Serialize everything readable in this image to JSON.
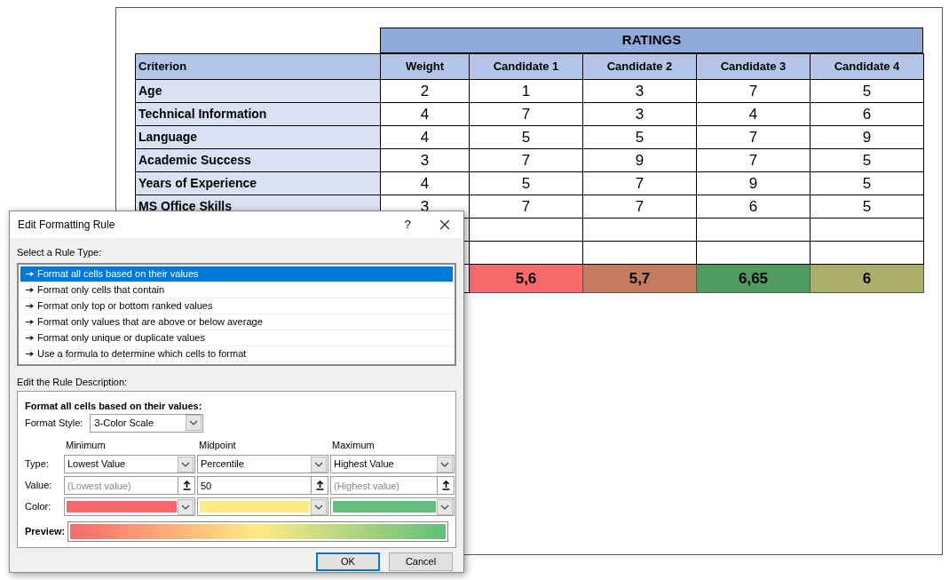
{
  "sheet": {
    "group_header": "RATINGS",
    "columns": [
      "Criterion",
      "Weight",
      "Candidate 1",
      "Candidate 2",
      "Candidate 3",
      "Candidate 4"
    ],
    "rows": [
      {
        "criterion": "Age",
        "values": [
          "2",
          "1",
          "3",
          "7",
          "5"
        ]
      },
      {
        "criterion": "Technical Information",
        "values": [
          "4",
          "7",
          "3",
          "4",
          "6"
        ]
      },
      {
        "criterion": "Language",
        "values": [
          "4",
          "5",
          "5",
          "7",
          "9"
        ]
      },
      {
        "criterion": "Academic Success",
        "values": [
          "3",
          "7",
          "9",
          "7",
          "5"
        ]
      },
      {
        "criterion": "Years of Experience",
        "values": [
          "4",
          "5",
          "7",
          "9",
          "5"
        ]
      },
      {
        "criterion": "MS Office Skills",
        "values": [
          "3",
          "7",
          "7",
          "6",
          "5"
        ]
      }
    ],
    "totals": [
      {
        "value": "5,6",
        "color": "#f8696b"
      },
      {
        "value": "5,7",
        "color": "#c47b5f"
      },
      {
        "value": "6,65",
        "color": "#4f9a5f"
      },
      {
        "value": "6",
        "color": "#abae6b"
      }
    ]
  },
  "dialog": {
    "title": "Edit Formatting Rule",
    "help": "?",
    "rule_type_label": "Select a Rule Type:",
    "rule_types": [
      {
        "label": "Format all cells based on their values",
        "selected": true
      },
      {
        "label": "Format only cells that contain",
        "selected": false
      },
      {
        "label": "Format only top or bottom ranked values",
        "selected": false
      },
      {
        "label": "Format only values that are above or below average",
        "selected": false
      },
      {
        "label": "Format only unique or duplicate values",
        "selected": false
      },
      {
        "label": "Use a formula to determine which cells to format",
        "selected": false
      }
    ],
    "description_label": "Edit the Rule Description:",
    "description": {
      "heading": "Format all cells based on their values:",
      "format_style_label": "Format Style:",
      "format_style": "3-Color Scale",
      "row_labels": [
        "Type:",
        "Value:",
        "Color:"
      ],
      "points": [
        {
          "header": "Minimum",
          "type": "Lowest Value",
          "placeholder": "(Lowest value)",
          "color": "#f8696b"
        },
        {
          "header": "Midpoint",
          "type": "Percentile",
          "value": "50",
          "color": "#ffeb84"
        },
        {
          "header": "Maximum",
          "type": "Highest Value",
          "placeholder": "(Highest value)",
          "color": "#63be7b"
        }
      ],
      "preview_label": "Preview:"
    },
    "buttons": [
      {
        "label": "OK",
        "default": true
      },
      {
        "label": "Cancel",
        "default": false
      }
    ]
  }
}
